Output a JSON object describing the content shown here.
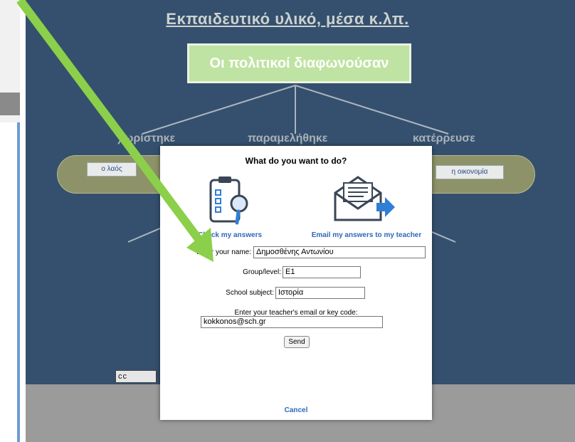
{
  "sheet": {
    "title": "Εκπαιδευτικό υλικό, μέσα κ.λπ.",
    "main_box": "Οι πολιτικοί διαφωνούσαν",
    "branches": [
      "χωρίστηκε",
      "παραμελήθηκε",
      "κατέρρευσε"
    ],
    "drop_left": "ο λαός",
    "drop_right": "η οικονομία",
    "license_badge": "cc"
  },
  "dialog": {
    "title": "What do you want to do?",
    "option_check": "Check my answers",
    "option_email": "Email my answers to my teacher",
    "name_label": "Enter your name:",
    "name_value": "Δημοσθένης Αντωνίου",
    "group_label": "Group/level:",
    "group_value": "E1",
    "subject_label": "School subject:",
    "subject_value": "Ιστορία",
    "email_label": "Enter your teacher's email or key code:",
    "email_value": "kokkonos@sch.gr",
    "send_label": "Send",
    "cancel_label": "Cancel"
  },
  "colors": {
    "sheet_bg": "#35506e",
    "main_box": "#bfe3a2",
    "arrow": "#8ccf4a",
    "link_blue": "#3068b8",
    "icon_blue": "#2f7fd6"
  },
  "icons": [
    "clipboard-checklist-icon",
    "magnifier-icon",
    "envelope-icon",
    "send-arrow-icon",
    "creative-commons-icon"
  ]
}
